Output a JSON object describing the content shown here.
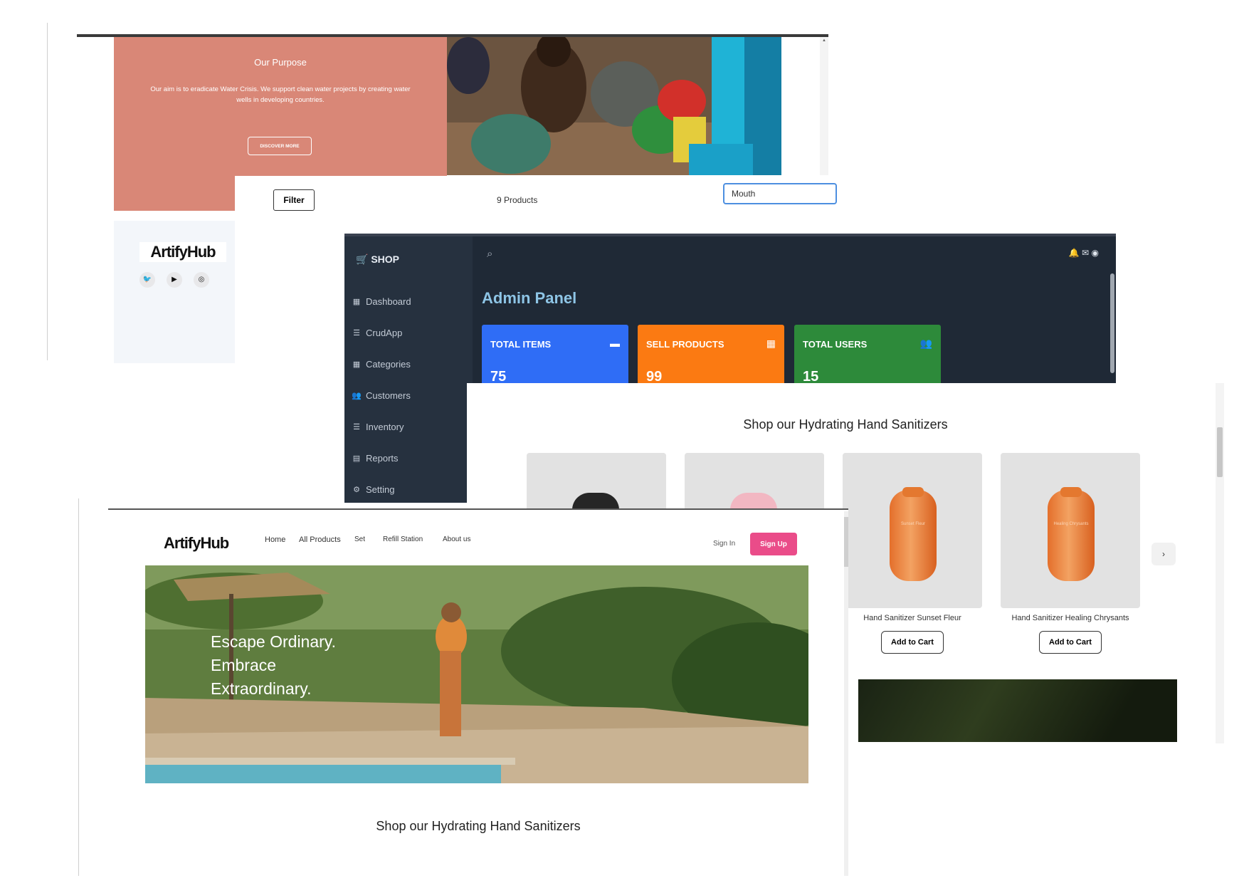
{
  "purpose": {
    "title": "Our Purpose",
    "text": "Our aim is to eradicate Water Crisis. We support clean water projects by creating water wells in developing countries.",
    "button": "DISCOVER MORE",
    "brand_logo": "ArtifyHub",
    "social_icons": [
      "twitter-icon",
      "youtube-icon",
      "instagram-icon"
    ]
  },
  "filterbar": {
    "filter_label": "Filter",
    "count": "9 Products",
    "search_value": "Mouth"
  },
  "admin": {
    "brand": "SHOP",
    "nav": [
      {
        "label": "Dashboard",
        "icon": "dashboard-icon"
      },
      {
        "label": "CrudApp",
        "icon": "list-icon"
      },
      {
        "label": "Categories",
        "icon": "grid-icon"
      },
      {
        "label": "Customers",
        "icon": "users-icon"
      },
      {
        "label": "Inventory",
        "icon": "list-icon"
      },
      {
        "label": "Reports",
        "icon": "report-icon"
      },
      {
        "label": "Setting",
        "icon": "gear-icon"
      }
    ],
    "title": "Admin Panel",
    "cards": [
      {
        "label": "TOTAL ITEMS",
        "value": "75",
        "icon": "archive-icon",
        "color": "#2f6df6"
      },
      {
        "label": "SELL PRODUCTS",
        "value": "99",
        "icon": "grid-icon",
        "color": "#fb7a12"
      },
      {
        "label": "TOTAL USERS",
        "value": "15",
        "icon": "users-icon",
        "color": "#2d8a3a"
      }
    ]
  },
  "products": {
    "heading": "Shop our Hydrating Hand Sanitizers",
    "items": [
      {
        "name": "",
        "button": ""
      },
      {
        "name": "",
        "button": ""
      },
      {
        "name": "Hand Sanitizer Sunset Fleur",
        "button": "Add to Cart",
        "bottle_label": "Sunset Fleur"
      },
      {
        "name": "Hand Sanitizer Healing Chrysants",
        "button": "Add to Cart",
        "bottle_label": "Healing Chrysants"
      }
    ],
    "next": "›"
  },
  "home": {
    "logo": "ArtifyHub",
    "nav": [
      "Home",
      "All Products",
      "Set",
      "Refill Station",
      "About us"
    ],
    "signin": "Sign In",
    "signup": "Sign Up",
    "hero_lines": [
      "Escape Ordinary.",
      "Embrace",
      "Extraordinary."
    ],
    "shop_heading": "Shop our Hydrating Hand Sanitizers"
  }
}
